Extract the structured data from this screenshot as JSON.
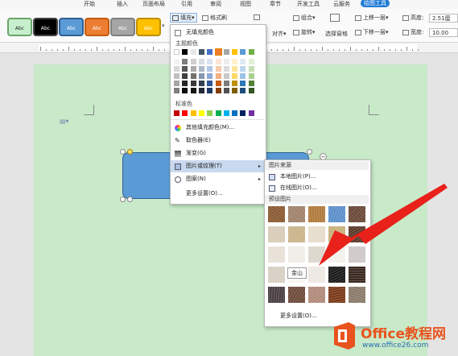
{
  "menubar": {
    "tabs": [
      "开始",
      "插入",
      "页面布局",
      "引用",
      "审阅",
      "视图",
      "章节",
      "开发工具",
      "云服务",
      "绘图工具"
    ],
    "active_tab": "绘图工具"
  },
  "ribbon": {
    "shape_styles": [
      {
        "label": "Abc",
        "bg": "#c6efce",
        "fg": "#222222",
        "border": "#6aa56a"
      },
      {
        "label": "Abc",
        "bg": "#000000",
        "fg": "#ffffff",
        "border": "#444444"
      },
      {
        "label": "Abc",
        "bg": "#5b9bd5",
        "fg": "#ffffff",
        "border": "#2e5f93"
      },
      {
        "label": "Abc",
        "bg": "#ed7d31",
        "fg": "#ffffff",
        "border": "#c55a11"
      },
      {
        "label": "Abc",
        "bg": "#a5a5a5",
        "fg": "#ffffff",
        "border": "#7f7f7f"
      },
      {
        "label": "Abc",
        "bg": "#ffc000",
        "fg": "#ffffff",
        "border": "#bf9000"
      }
    ],
    "fill_label": "填充",
    "format_brush_label": "格式刷",
    "align_label": "对齐",
    "combine_label": "组合",
    "rotate_label": "旋转",
    "select_pane_label": "选择窗格",
    "bring_forward_label": "上移一层",
    "send_backward_label": "下移一层",
    "height_label": "高度:",
    "height_value": "2.51厘",
    "width_label": "宽度:",
    "width_value": "10.00"
  },
  "fill_menu": {
    "no_fill": "无填充颜色",
    "theme_colors_label": "主题颜色",
    "theme_top": [
      "#ffffff",
      "#000000",
      "#e7e6e6",
      "#44546a",
      "#4472c4",
      "#ed7d31",
      "#a5a5a5",
      "#ffc000",
      "#5b9bd5",
      "#70ad47"
    ],
    "theme_shades": [
      [
        "#f2f2f2",
        "#7f7f7f",
        "#d0cece",
        "#d6dce4",
        "#d9e2f3",
        "#fbe5d5",
        "#ededed",
        "#fff2cc",
        "#deebf6",
        "#e2efd9"
      ],
      [
        "#d8d8d8",
        "#595959",
        "#aeabab",
        "#adb9ca",
        "#b4c6e7",
        "#f7cbac",
        "#dbdbdb",
        "#fee599",
        "#bdd7ee",
        "#c5e0b3"
      ],
      [
        "#bfbfbf",
        "#3f3f3f",
        "#757070",
        "#8496b0",
        "#8eaadb",
        "#f4b183",
        "#c9c9c9",
        "#ffd965",
        "#9cc3e5",
        "#a8d08d"
      ],
      [
        "#a5a5a5",
        "#262626",
        "#3a3838",
        "#323f4f",
        "#2f5496",
        "#c55a11",
        "#7b7b7b",
        "#bf9000",
        "#2e75b5",
        "#538135"
      ],
      [
        "#7f7f7f",
        "#0c0c0c",
        "#171616",
        "#222a35",
        "#1f3864",
        "#833c0b",
        "#525252",
        "#7f6000",
        "#1e4e79",
        "#375623"
      ]
    ],
    "standard_colors_label": "标准色",
    "standard_colors": [
      "#c00000",
      "#ff0000",
      "#ffc000",
      "#ffff00",
      "#92d050",
      "#00b050",
      "#00b0f0",
      "#0070c0",
      "#002060",
      "#7030a0"
    ],
    "more_fill_colors": "其他填充颜色(M)...",
    "eyedropper": "取色器(E)",
    "gradient": "渐变(G)",
    "picture_texture": "图片或纹理(T)",
    "pattern": "图案(N)",
    "more_settings": "更多设置(O)..."
  },
  "texture_menu": {
    "picture_source_label": "图片来源",
    "local_picture": "本地图片(P)...",
    "online_picture": "在线图片(O)...",
    "preset_label": "预设图片",
    "textures": [
      [
        "#8a5a33",
        "#a0826a",
        "#b07a3c",
        "#5b8fc9",
        "#6b4a3a"
      ],
      [
        "#d8ccb8",
        "#c9b48a",
        "#e6dccb",
        "#c8b07a",
        "#5a3a2a"
      ],
      [
        "#e8e0d6",
        "#f0ece6",
        "#dcd6cc",
        "#f4f1ec",
        "#cfc8c8"
      ],
      [
        "#d8cfc4",
        "#f8f6f2",
        "#ede8e2",
        "#1a1a1a",
        "#3a2a22"
      ],
      [
        "#4a3f42",
        "#6e4a3a",
        "#b08a7a",
        "#7a3a1a",
        "#8a7a6a"
      ]
    ],
    "tooltip": "金山",
    "more_settings": "更多设置(O)..."
  },
  "watermark": {
    "brand": "Office教程网",
    "url": "www.office26.com"
  }
}
